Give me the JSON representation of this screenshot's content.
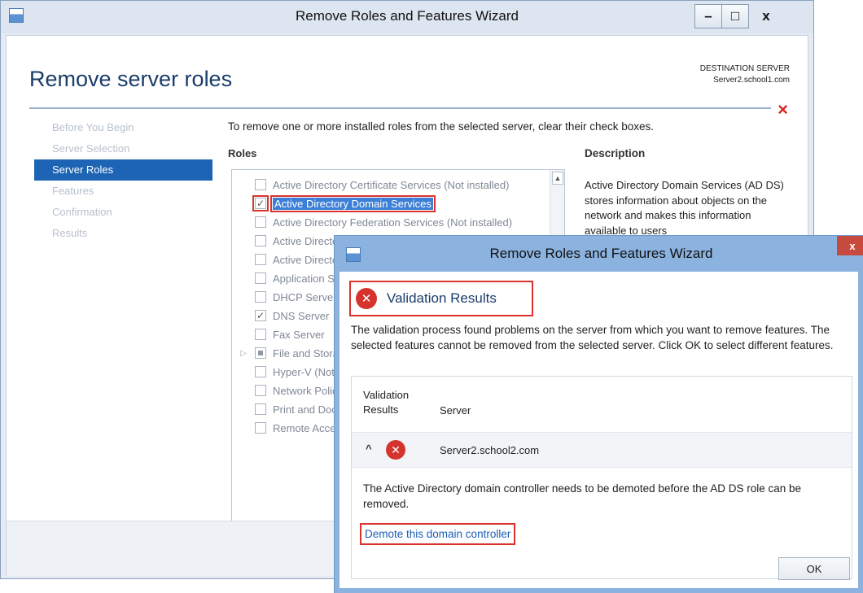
{
  "main_window": {
    "title": "Remove Roles and Features Wizard",
    "buttons": {
      "minimize": "–",
      "maximize": "□",
      "close": "x"
    },
    "page_title": "Remove server roles",
    "destination_label": "DESTINATION SERVER",
    "destination_server": "Server2.school1.com",
    "header_close": "×",
    "nav": [
      {
        "label": "Before You Begin",
        "active": false
      },
      {
        "label": "Server Selection",
        "active": false
      },
      {
        "label": "Server Roles",
        "active": true
      },
      {
        "label": "Features",
        "active": false
      },
      {
        "label": "Confirmation",
        "active": false
      },
      {
        "label": "Results",
        "active": false
      }
    ],
    "instruction": "To remove one or more installed roles from the selected server, clear their check boxes.",
    "roles_heading": "Roles",
    "description_heading": "Description",
    "description_text": "Active Directory Domain Services (AD DS) stores information about objects on the network and makes this information available to users",
    "roles": [
      {
        "label": "Active Directory Certificate Services (Not installed)",
        "checked": false
      },
      {
        "label": "Active Directory Domain Services",
        "checked": true,
        "selected": true
      },
      {
        "label": "Active Directory Federation Services (Not installed)",
        "checked": false
      },
      {
        "label": "Active Directory Lightweight Directory Services",
        "checked": false
      },
      {
        "label": "Active Directory Rights Management Services",
        "checked": false
      },
      {
        "label": "Application Server",
        "checked": false
      },
      {
        "label": "DHCP Server",
        "checked": false
      },
      {
        "label": "DNS Server",
        "checked": true
      },
      {
        "label": "Fax Server",
        "checked": false
      },
      {
        "label": "File and Storage Services",
        "checked": "partial",
        "expandable": true
      },
      {
        "label": "Hyper-V (Not installed)",
        "checked": false
      },
      {
        "label": "Network Policy and Access Services",
        "checked": false
      },
      {
        "label": "Print and Document Services",
        "checked": false
      },
      {
        "label": "Remote Access",
        "checked": false
      }
    ]
  },
  "dialog": {
    "title": "Remove Roles and Features Wizard",
    "close": "x",
    "header_title": "Validation Results",
    "message": "The validation process found problems on the server from which you want to remove features. The selected features cannot be removed from the selected server.  Click OK to select different features.",
    "col_validation": "Validation Results",
    "col_server": "Server",
    "result_server": "Server2.school2.com",
    "detail": "The Active Directory domain controller needs to be demoted before the AD DS role can be removed.",
    "link": "Demote this domain controller",
    "ok": "OK",
    "error_glyph": "✕",
    "caret": "^"
  },
  "colors": {
    "accent": "#1d65b4",
    "error": "#d4342d",
    "highlight_box": "#d9332b",
    "link": "#1a5fb4"
  }
}
